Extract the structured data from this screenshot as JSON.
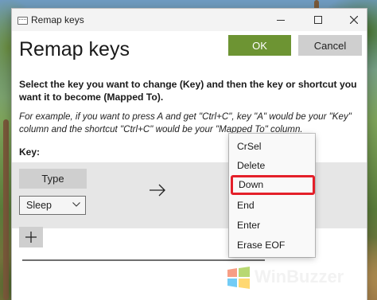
{
  "window": {
    "title": "Remap keys",
    "heading": "Remap keys",
    "ok_label": "OK",
    "cancel_label": "Cancel"
  },
  "content": {
    "instruction": "Select the key you want to change (Key) and then the key or shortcut you want it to become (Mapped To).",
    "example": "For example, if you want to press A and get \"Ctrl+C\", key \"A\" would be your \"Key\" column and the shortcut \"Ctrl+C\" would be your \"Mapped To\" column.",
    "key_column_label": "Key:"
  },
  "mapping_row": {
    "type_button_label": "Type",
    "key_value": "Sleep",
    "arrow_glyph": "→"
  },
  "dropdown": {
    "items": [
      "CrSel",
      "Delete",
      "Down",
      "End",
      "Enter",
      "Erase EOF"
    ],
    "highlighted": "Down"
  },
  "icons": {
    "close": "close-icon",
    "minimize": "minimize-icon",
    "maximize": "maximize-icon",
    "add": "plus-icon",
    "arrow": "arrow-right-icon"
  },
  "watermark": "WinBuzzer",
  "colors": {
    "ok_button": "#6d9433",
    "highlight_border": "#e4202a"
  }
}
